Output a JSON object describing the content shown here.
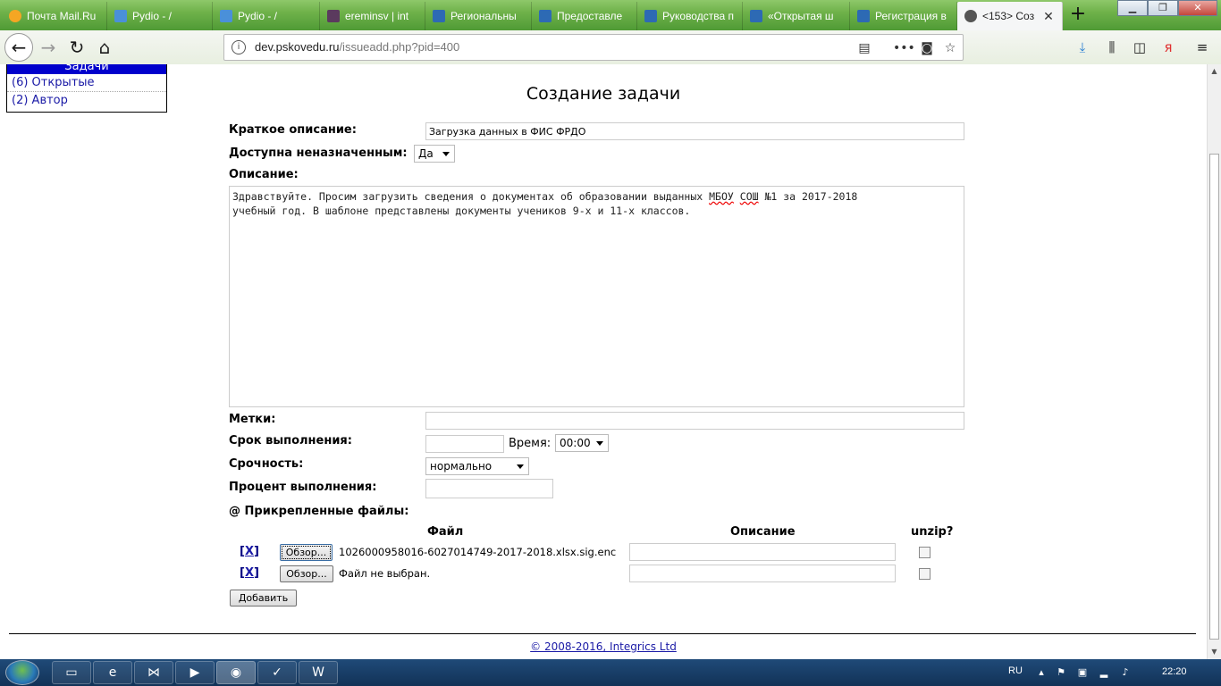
{
  "browser": {
    "tabs": [
      {
        "title": "Почта Mail.Ru",
        "color": "#f5a623"
      },
      {
        "title": "Pydio - /",
        "color": "#4a90d9"
      },
      {
        "title": "Pydio - /",
        "color": "#4a90d9"
      },
      {
        "title": "ereminsv | int",
        "color": "#5b3a5e"
      },
      {
        "title": "Региональны",
        "color": "#2d6ab4"
      },
      {
        "title": "Предоставле",
        "color": "#2d6ab4"
      },
      {
        "title": "Руководства п",
        "color": "#2d6ab4"
      },
      {
        "title": "«Открытая ш",
        "color": "#2d6ab4"
      },
      {
        "title": "Регистрация в",
        "color": "#2d6ab4"
      },
      {
        "title": "<153> Соз",
        "color": "#555555",
        "active": true
      }
    ],
    "new_tab": "+",
    "url_domain": "dev.pskovedu.ru",
    "url_path": "/issueadd.php?pid=400"
  },
  "sidebar": {
    "header": "Задачи",
    "items": [
      {
        "label": "(6) Открытые"
      },
      {
        "label": "(2) Автор"
      }
    ]
  },
  "form": {
    "title": "Создание задачи",
    "summary_label": "Краткое описание:",
    "summary_value": "Загрузка данных в ФИС ФРДО",
    "unassigned_label": "Доступна неназначенным:",
    "unassigned_value": "Да",
    "description_label": "Описание:",
    "description_part1": "Здравствуйте. Просим загрузить сведения о документах об образовании выданных ",
    "description_sq1": "МБОУ",
    "description_part2": " ",
    "description_sq2": "СОШ",
    "description_part3": " №1 за 2017-2018\nучебный год. В шаблоне представлены документы учеников 9-х и 11-х классов.",
    "tags_label": "Метки:",
    "due_label": "Срок выполнения:",
    "time_label": "Время:",
    "time_value": "00:00",
    "urgency_label": "Срочность:",
    "urgency_value": "нормально",
    "percent_label": "Процент выполнения:",
    "attachments_label": "@ Прикрепленные файлы:",
    "col_file": "Файл",
    "col_description": "Описание",
    "col_unzip": "unzip?",
    "rows": [
      {
        "remove": "X",
        "browse": "Обзор...",
        "file": "1026000958016-6027014749-2017-2018.xlsx.sig.enc"
      },
      {
        "remove": "X",
        "browse": "Обзор...",
        "file": "Файл не выбран."
      }
    ],
    "add_button": "Добавить"
  },
  "footer": {
    "copyright": "© 2008-2016, Integrics Ltd"
  },
  "taskbar": {
    "lang": "RU",
    "clock": "22:20"
  }
}
